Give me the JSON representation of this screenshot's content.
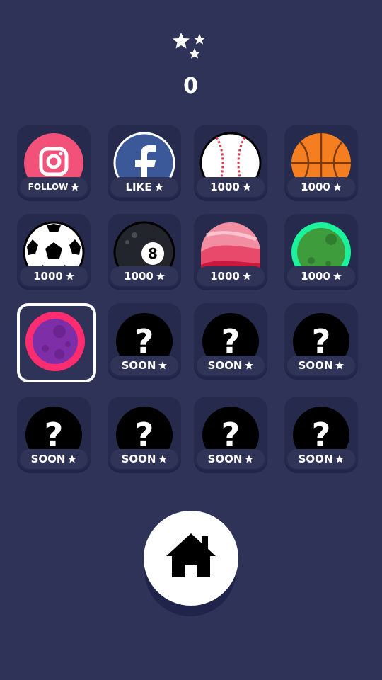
{
  "header": {
    "stars_icon": "stars-icon",
    "star_count": "0"
  },
  "tiles": [
    {
      "kind": "instagram",
      "label": "FOLLOW",
      "locked": false,
      "selected": false
    },
    {
      "kind": "facebook",
      "label": "LIKE",
      "locked": false,
      "selected": false
    },
    {
      "kind": "baseball",
      "label": "1000",
      "locked": false,
      "selected": false
    },
    {
      "kind": "basketball",
      "label": "1000",
      "locked": false,
      "selected": false
    },
    {
      "kind": "soccer",
      "label": "1000",
      "locked": false,
      "selected": false
    },
    {
      "kind": "eightball",
      "label": "1000",
      "locked": false,
      "selected": false
    },
    {
      "kind": "pink-ball",
      "label": "1000",
      "locked": false,
      "selected": false
    },
    {
      "kind": "green-moon",
      "label": "1000",
      "locked": false,
      "selected": false
    },
    {
      "kind": "purple-moon",
      "label": "",
      "locked": false,
      "selected": true
    },
    {
      "kind": "mystery",
      "label": "SOON",
      "locked": true,
      "selected": false
    },
    {
      "kind": "mystery",
      "label": "SOON",
      "locked": true,
      "selected": false
    },
    {
      "kind": "mystery",
      "label": "SOON",
      "locked": true,
      "selected": false
    },
    {
      "kind": "mystery",
      "label": "SOON",
      "locked": true,
      "selected": false
    },
    {
      "kind": "mystery",
      "label": "SOON",
      "locked": true,
      "selected": false
    },
    {
      "kind": "mystery",
      "label": "SOON",
      "locked": true,
      "selected": false
    },
    {
      "kind": "mystery",
      "label": "SOON",
      "locked": true,
      "selected": false
    }
  ],
  "home_button": {
    "icon": "home-icon"
  },
  "colors": {
    "background": "#2f3358",
    "tile": "#262a4d",
    "selected_border": "#ffffff",
    "instagram": "#f2527a",
    "facebook": "#3b5998",
    "basketball": "#f57f20",
    "green_moon": "#1cf29b",
    "purple_moon_ring": "#ff2d6f"
  }
}
